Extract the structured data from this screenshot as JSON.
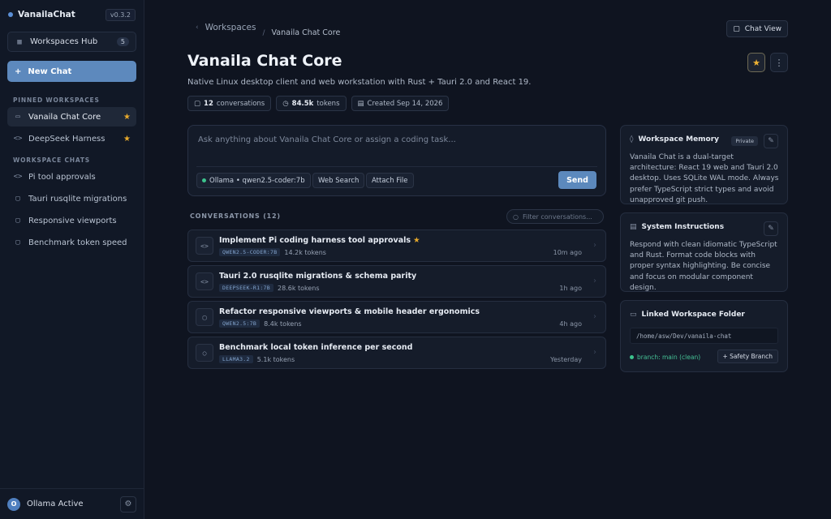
{
  "sidebar": {
    "brand": "VanailaChat",
    "version": "v0.3.2",
    "hub": {
      "label": "Workspaces Hub",
      "count": "5"
    },
    "new_chat": "New Chat",
    "pinned_title": "PINNED WORKSPACES",
    "pinned": [
      {
        "label": "Vanaila Chat Core",
        "icon": "folder-icon",
        "starred": true
      },
      {
        "label": "DeepSeek Harness",
        "icon": "code-icon",
        "starred": true
      }
    ],
    "chats_title": "WORKSPACE CHATS",
    "chats": [
      {
        "label": "Pi tool approvals",
        "icon": "code-icon"
      },
      {
        "label": "Tauri rusqlite migrations",
        "icon": "chat-icon"
      },
      {
        "label": "Responsive viewports",
        "icon": "chat-icon"
      },
      {
        "label": "Benchmark token speed",
        "icon": "chat-icon"
      }
    ],
    "footer": {
      "avatar": "O",
      "status": "Ollama Active"
    }
  },
  "header": {
    "breadcrumb_root": "Workspaces",
    "breadcrumb_current": "Vanaila Chat Core",
    "chat_view": "Chat View",
    "title": "Vanaila Chat Core",
    "subtitle": "Native Linux desktop client and web workstation with Rust + Tauri 2.0 and React 19.",
    "stats": {
      "conversations_count": "12",
      "conversations_label": "conversations",
      "tokens_count": "84.5k",
      "tokens_label": "tokens",
      "created": "Created Sep 14, 2026"
    }
  },
  "composer": {
    "placeholder": "Ask anything about Vanaila Chat Core or assign a coding task...",
    "model": "Ollama • qwen2.5-coder:7b",
    "web_search": "Web Search",
    "attach_file": "Attach File",
    "send": "Send"
  },
  "conversations": {
    "title": "CONVERSATIONS (12)",
    "filter_placeholder": "Filter conversations...",
    "items": [
      {
        "title": "Implement Pi coding harness tool approvals",
        "starred": true,
        "model": "QWEN2.5-CODER:7B",
        "tokens": "14.2k tokens",
        "time": "10m ago",
        "icon": "code-icon"
      },
      {
        "title": "Tauri 2.0 rusqlite migrations & schema parity",
        "starred": false,
        "model": "DEEPSEEK-R1:7B",
        "tokens": "28.6k tokens",
        "time": "1h ago",
        "icon": "code-icon"
      },
      {
        "title": "Refactor responsive viewports & mobile header ergonomics",
        "starred": false,
        "model": "QWEN2.5:7B",
        "tokens": "8.4k tokens",
        "time": "4h ago",
        "icon": "chat-icon"
      },
      {
        "title": "Benchmark local token inference per second",
        "starred": false,
        "model": "LLAMA3.2",
        "tokens": "5.1k tokens",
        "time": "Yesterday",
        "icon": "search-icon"
      }
    ]
  },
  "panels": {
    "memory": {
      "title": "Workspace Memory",
      "badge": "Private",
      "body": "Vanaila Chat is a dual-target architecture: React 19 web and Tauri 2.0 desktop. Uses SQLite WAL mode. Always prefer TypeScript strict types and avoid unapproved git push."
    },
    "instructions": {
      "title": "System Instructions",
      "body": "Respond with clean idiomatic TypeScript and Rust. Format code blocks with proper syntax highlighting. Be concise and focus on modular component design."
    },
    "folder": {
      "title": "Linked Workspace Folder",
      "path": "/home/asw/Dev/vanaila-chat",
      "branch": "branch: main (clean)",
      "safety_branch": "+ Safety Branch"
    }
  },
  "colors": {
    "accent": "#5d89bd",
    "star": "#e7a92b",
    "success": "#3cc38d",
    "background": "#0f1420"
  }
}
